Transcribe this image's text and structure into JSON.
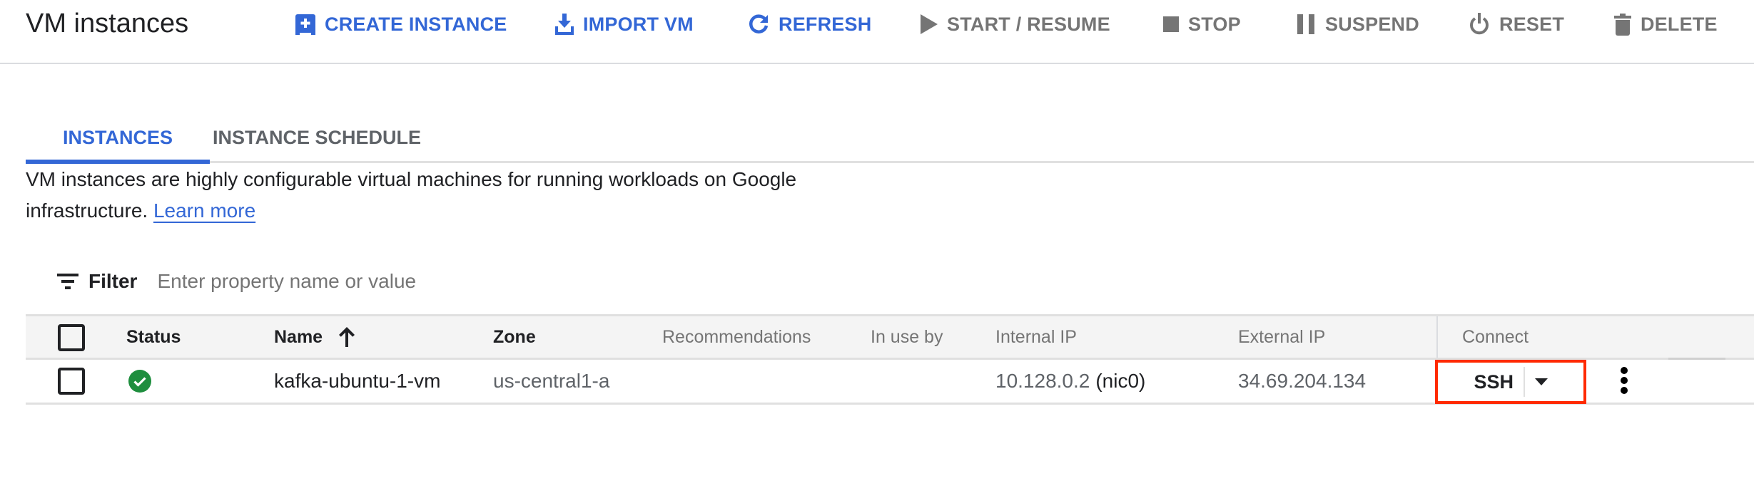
{
  "header": {
    "title": "VM instances",
    "actions": [
      {
        "label": "CREATE INSTANCE",
        "icon": "add-box-icon",
        "enabled": true
      },
      {
        "label": "IMPORT VM",
        "icon": "download-icon",
        "enabled": true
      },
      {
        "label": "REFRESH",
        "icon": "refresh-icon",
        "enabled": true
      },
      {
        "label": "START / RESUME",
        "icon": "play-icon",
        "enabled": false
      },
      {
        "label": "STOP",
        "icon": "stop-icon",
        "enabled": false
      },
      {
        "label": "SUSPEND",
        "icon": "pause-icon",
        "enabled": false
      },
      {
        "label": "RESET",
        "icon": "power-icon",
        "enabled": false
      },
      {
        "label": "DELETE",
        "icon": "trash-icon",
        "enabled": false
      }
    ]
  },
  "tabs": [
    {
      "label": "INSTANCES",
      "active": true
    },
    {
      "label": "INSTANCE SCHEDULE",
      "active": false
    }
  ],
  "description": {
    "text": "VM instances are highly configurable virtual machines for running workloads on Google infrastructure.",
    "link": "Learn more"
  },
  "filter": {
    "label": "Filter",
    "placeholder": "Enter property name or value",
    "value": ""
  },
  "table": {
    "columns": [
      "Status",
      "Name",
      "Zone",
      "Recommendations",
      "In use by",
      "Internal IP",
      "External IP",
      "Connect"
    ],
    "sort": {
      "column": "Name",
      "direction": "ascending"
    },
    "rows": [
      {
        "selected": false,
        "status": "running",
        "name": "kafka-ubuntu-1-vm",
        "zone": "us-central1-a",
        "recommendations": "",
        "in_use_by": "",
        "internal_ip": "10.128.0.2",
        "internal_ip_nic": "(nic0)",
        "external_ip": "34.69.204.134",
        "connect": "SSH"
      }
    ]
  },
  "colors": {
    "accent": "#3367d6",
    "status_ok": "#1e8e3e",
    "highlight": "#ff2a00",
    "disabled": "#757575"
  }
}
